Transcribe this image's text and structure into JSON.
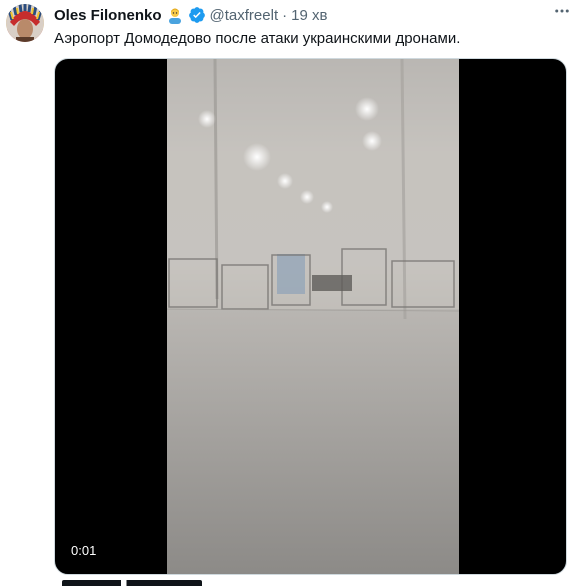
{
  "tweet": {
    "display_name": "Oles Filonenko",
    "emoji": "person-raising-hand-emoji",
    "verified_icon": "verified-badge-icon",
    "handle": "@taxfreelt",
    "separator": "·",
    "time": "19 хв",
    "more_icon": "more-options-icon",
    "text": "Аэропорт Домодедово после атаки украинскими дронами."
  },
  "media": {
    "type": "video",
    "timestamp": "0:01"
  },
  "colors": {
    "primary_text": "#0f1419",
    "secondary_text": "#536471",
    "verified_blue": "#1d9bf0",
    "border": "#cfd9de"
  }
}
